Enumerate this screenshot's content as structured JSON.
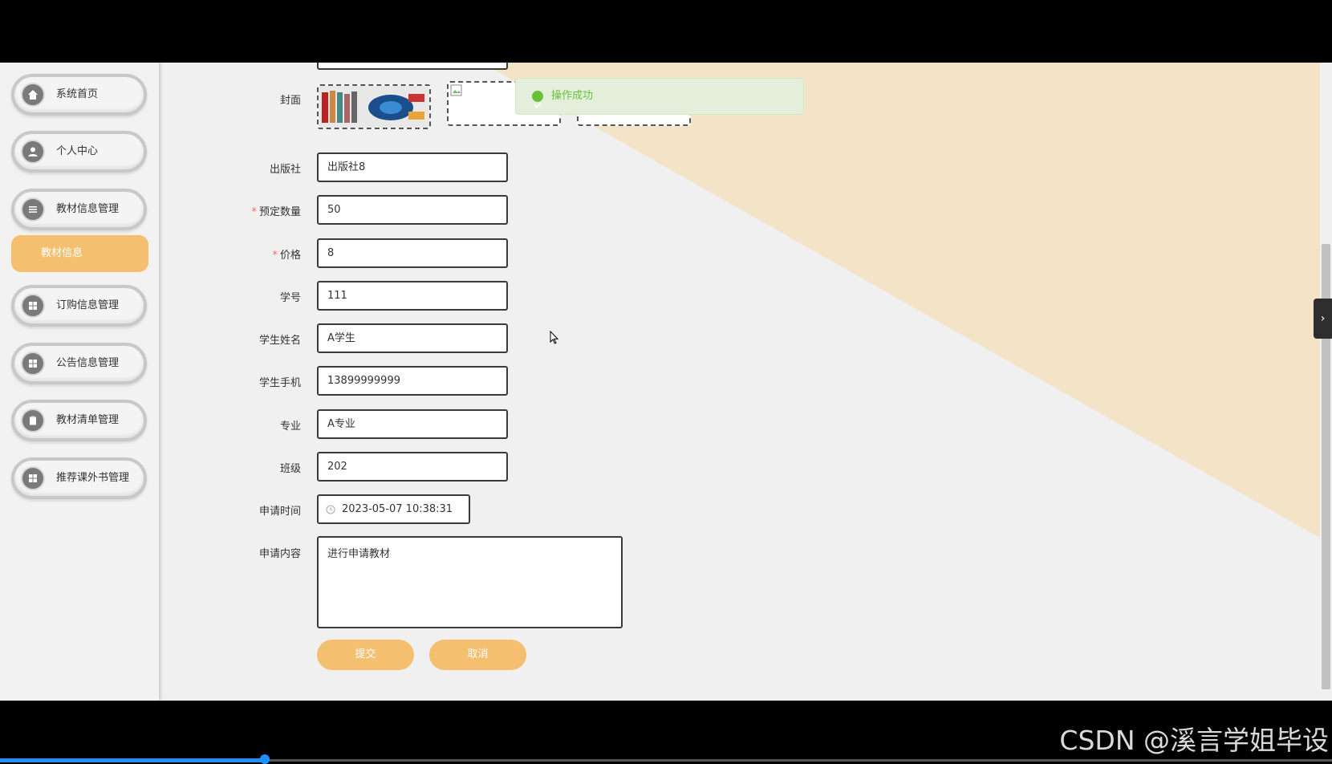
{
  "sidebar": {
    "items": [
      {
        "label": "系统首页",
        "icon": "home-icon"
      },
      {
        "label": "个人中心",
        "icon": "user-icon"
      },
      {
        "label": "教材信息管理",
        "icon": "list-icon"
      },
      {
        "label": "订购信息管理",
        "icon": "grid-icon"
      },
      {
        "label": "公告信息管理",
        "icon": "grid-icon"
      },
      {
        "label": "教材清单管理",
        "icon": "clipboard-icon"
      },
      {
        "label": "推荐课外书管理",
        "icon": "grid-icon"
      }
    ],
    "active_sub": "教材信息"
  },
  "form": {
    "cover_label": "封面",
    "publisher_label": "出版社",
    "publisher_value": "出版社8",
    "quantity_label": "预定数量",
    "quantity_value": "50",
    "price_label": "价格",
    "price_value": "8",
    "student_id_label": "学号",
    "student_id_value": "111",
    "student_name_label": "学生姓名",
    "student_name_value": "A学生",
    "student_phone_label": "学生手机",
    "student_phone_value": "13899999999",
    "major_label": "专业",
    "major_value": "A专业",
    "class_label": "班级",
    "class_value": "202",
    "apply_time_label": "申请时间",
    "apply_time_value": "2023-05-07 10:38:31",
    "apply_content_label": "申请内容",
    "apply_content_value": "进行申请教材",
    "required_mark": "*"
  },
  "buttons": {
    "submit": "提交",
    "cancel": "取消"
  },
  "toast": {
    "message": "操作成功"
  },
  "colors": {
    "accent": "#f5bf70",
    "success": "#67c23a",
    "background_tri": "#f3e3c7"
  },
  "watermark": "CSDN @溪言学姐毕设"
}
